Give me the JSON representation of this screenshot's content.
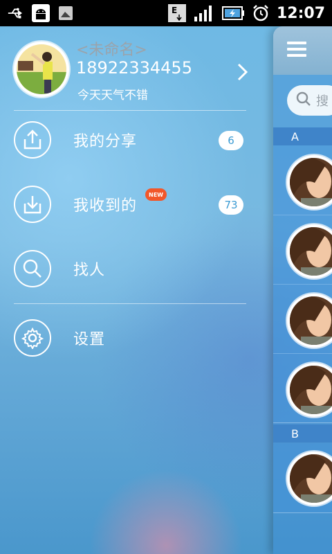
{
  "status_bar": {
    "time": "12:07",
    "network_label": "E",
    "icons": [
      "usb-icon",
      "android-debug-icon",
      "gallery-icon",
      "data-network-icon",
      "signal-icon",
      "battery-charging-icon",
      "alarm-icon"
    ]
  },
  "profile": {
    "name": "<未命名>",
    "phone": "18922334455",
    "status": "今天天气不错"
  },
  "menu": {
    "items": [
      {
        "label": "我的分享",
        "badge": "6",
        "icon": "share-icon"
      },
      {
        "label": "我收到的",
        "badge": "73",
        "tag": "NEW",
        "icon": "download-icon"
      },
      {
        "label": "找人",
        "icon": "search-icon"
      },
      {
        "label": "设置",
        "icon": "gear-icon"
      }
    ]
  },
  "contacts_panel": {
    "search_placeholder": "搜",
    "sections": [
      {
        "letter": "A",
        "count": 4
      },
      {
        "letter": "B",
        "count": 1
      }
    ]
  },
  "colors": {
    "accent": "#3b9bd3",
    "new_tag": "#f2572a",
    "section_header": "#3f84c9"
  }
}
